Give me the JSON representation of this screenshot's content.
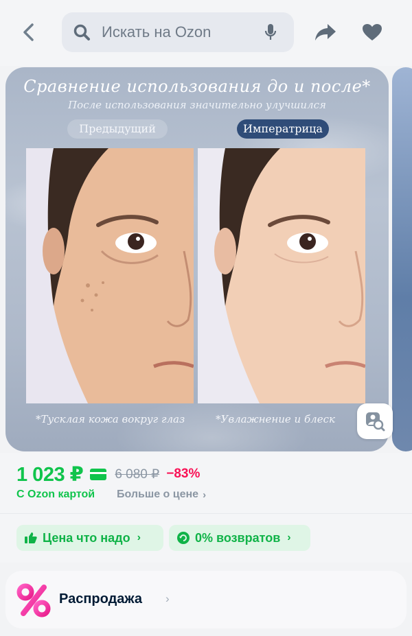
{
  "header": {
    "search_placeholder": "Искать на Ozon"
  },
  "gallery": {
    "title": "Сравнение использования до и после*",
    "subtitle": "После использования значительно улучшился",
    "label_before": "Предыдущий",
    "label_after": "Императрица",
    "caption_before": "*Тусклая кожа вокруг глаз",
    "caption_after": "*Увлажнение и блеск"
  },
  "price": {
    "current": "1 023 ₽",
    "old": "6 080 ₽",
    "discount": "−83%",
    "ozon_card_label": "С Ozon картой",
    "more_label": "Больше о цене",
    "chevron": "›"
  },
  "chips": [
    {
      "label": "Цена что надо",
      "icon": "thumbs-up-icon",
      "arrow": "›"
    },
    {
      "label": "0% возвратов",
      "icon": "return-icon",
      "arrow": "›"
    }
  ],
  "sale": {
    "label": "Распродажа",
    "chevron": "›",
    "icon": "percent-icon"
  },
  "colors": {
    "accent_green": "#10c44c",
    "discount_red": "#f91155",
    "badge_blue": "#2f4c78"
  }
}
